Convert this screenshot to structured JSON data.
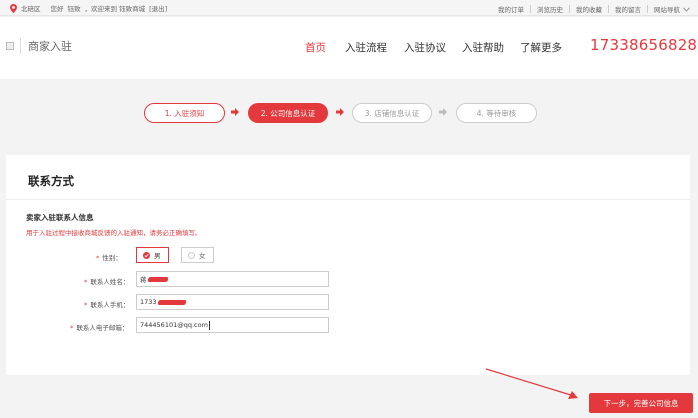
{
  "topbar": {
    "location": "北碚区",
    "greeting": "您好",
    "username": "钰致",
    "welcome": "，欢迎来到 钰致商城",
    "logout": "[退出]",
    "links": [
      "我的订单",
      "浏览历史",
      "我的收藏",
      "我的留言",
      "网站导航"
    ]
  },
  "header": {
    "logo_text": "商家入驻",
    "nav": [
      "首页",
      "入驻流程",
      "入驻协议",
      "入驻帮助",
      "了解更多"
    ],
    "phone": "17338656828"
  },
  "steps": [
    {
      "label": "1. 入驻须知",
      "state": "done"
    },
    {
      "label": "2. 公司信息认证",
      "state": "current"
    },
    {
      "label": "3. 店铺信息认证",
      "state": "todo"
    },
    {
      "label": "4. 等待审核",
      "state": "todo"
    }
  ],
  "form": {
    "title": "联系方式",
    "section_title": "卖家入驻联系人信息",
    "notice": "用于入驻过程中接收商城反馈的入驻通知，请务必正确填写。",
    "gender_label": "性别：",
    "gender_options": [
      "男",
      "女"
    ],
    "name_label": "联系人姓名：",
    "name_value": "蒋",
    "phone_label": "联系人手机：",
    "phone_value": "1733",
    "email_label": "联系人电子邮箱：",
    "email_value": "744456101@qq.com"
  },
  "actions": {
    "next_label": "下一步，完善公司信息"
  },
  "colors": {
    "accent": "#e4393c"
  }
}
